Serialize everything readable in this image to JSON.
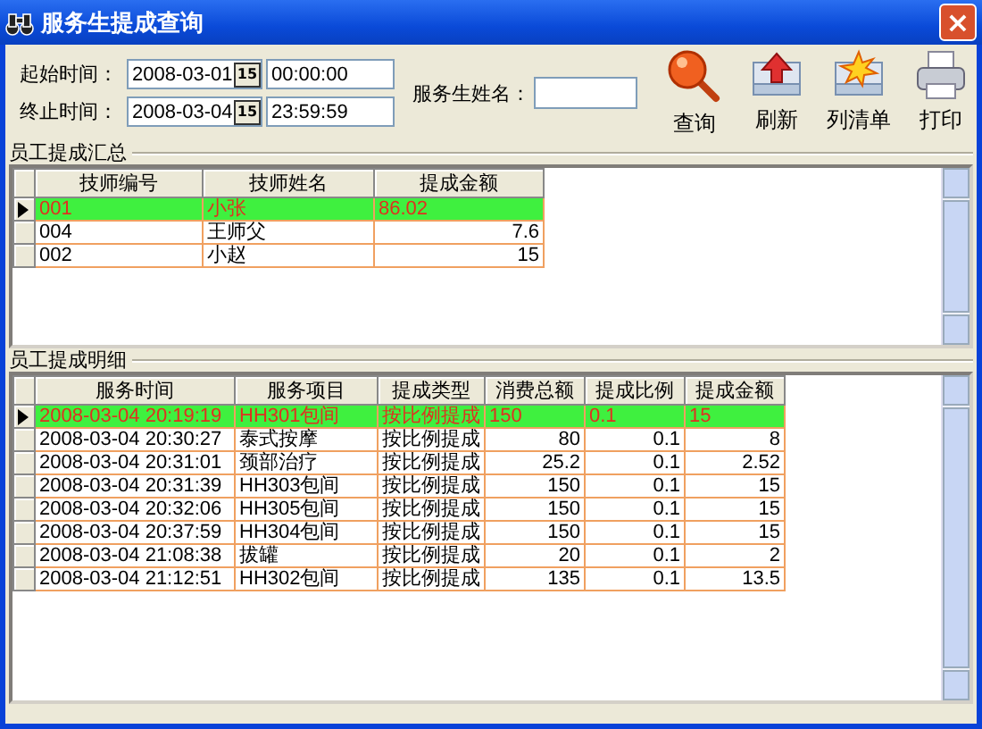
{
  "window": {
    "title": "服务生提成查询",
    "close": "×"
  },
  "filters": [
    {
      "label": "起始时间：",
      "date": "2008-03-01",
      "picker": "15",
      "time": "00:00:00"
    },
    {
      "label": "终止时间：",
      "date": "2008-03-04",
      "picker": "15",
      "time": "23:59:59"
    }
  ],
  "waiter_name": {
    "label": "服务生姓名："
  },
  "toolbar": [
    {
      "kind": "search",
      "label": "查询"
    },
    {
      "kind": "refresh",
      "label": "刷新"
    },
    {
      "kind": "list",
      "label": "列清单"
    },
    {
      "kind": "print",
      "label": "打印"
    }
  ],
  "summary": {
    "title": "员工提成汇总",
    "columns": [
      {
        "label": "技师编号",
        "kind": "text"
      },
      {
        "label": "技师姓名",
        "kind": "text"
      },
      {
        "label": "提成金额",
        "kind": "number"
      }
    ],
    "rows": [
      {
        "selected": true,
        "cells": [
          "001",
          "小张",
          "86.02"
        ]
      },
      {
        "selected": false,
        "cells": [
          "004",
          "王师父",
          "7.6"
        ]
      },
      {
        "selected": false,
        "cells": [
          "002",
          "小赵",
          "15"
        ]
      }
    ]
  },
  "details": {
    "title": "员工提成明细",
    "columns": [
      {
        "label": "服务时间",
        "kind": "text"
      },
      {
        "label": "服务项目",
        "kind": "text"
      },
      {
        "label": "提成类型",
        "kind": "text"
      },
      {
        "label": "消费总额",
        "kind": "number"
      },
      {
        "label": "提成比例",
        "kind": "number"
      },
      {
        "label": "提成金额",
        "kind": "number"
      }
    ],
    "rows": [
      {
        "selected": true,
        "cells": [
          "2008-03-04 20:19:19",
          "HH301包间",
          "按比例提成",
          "150",
          "0.1",
          "15"
        ]
      },
      {
        "selected": false,
        "cells": [
          "2008-03-04 20:30:27",
          "泰式按摩",
          "按比例提成",
          "80",
          "0.1",
          "8"
        ]
      },
      {
        "selected": false,
        "cells": [
          "2008-03-04 20:31:01",
          "颈部治疗",
          "按比例提成",
          "25.2",
          "0.1",
          "2.52"
        ]
      },
      {
        "selected": false,
        "cells": [
          "2008-03-04 20:31:39",
          "HH303包间",
          "按比例提成",
          "150",
          "0.1",
          "15"
        ]
      },
      {
        "selected": false,
        "cells": [
          "2008-03-04 20:32:06",
          "HH305包间",
          "按比例提成",
          "150",
          "0.1",
          "15"
        ]
      },
      {
        "selected": false,
        "cells": [
          "2008-03-04 20:37:59",
          "HH304包间",
          "按比例提成",
          "150",
          "0.1",
          "15"
        ]
      },
      {
        "selected": false,
        "cells": [
          "2008-03-04 21:08:38",
          "拔罐",
          "按比例提成",
          "20",
          "0.1",
          "2"
        ]
      },
      {
        "selected": false,
        "cells": [
          "2008-03-04 21:12:51",
          "HH302包间",
          "按比例提成",
          "135",
          "0.1",
          "13.5"
        ]
      }
    ]
  }
}
